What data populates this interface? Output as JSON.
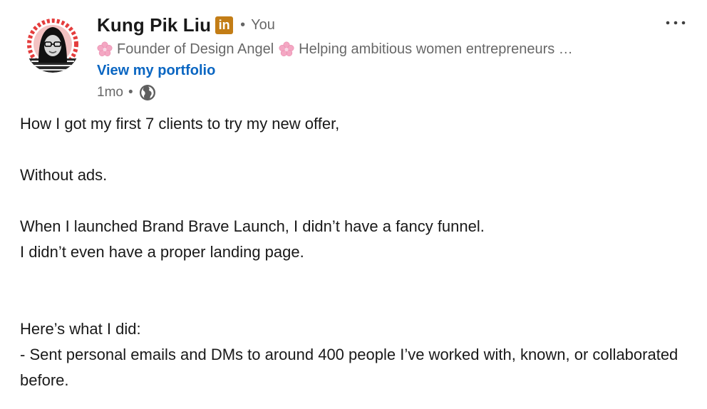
{
  "post": {
    "author": {
      "name": "Kung Pik Liu",
      "badge": "in",
      "separator": "•",
      "relation": "You",
      "headline_part1": "Founder of Design Angel",
      "headline_part2": "Helping ambitious women entrepreneurs …",
      "portfolio_link": "View my portfolio",
      "avatar_icon": "profile-photo"
    },
    "meta": {
      "age": "1mo",
      "separator": "•",
      "visibility_icon": "globe-icon"
    },
    "menu_icon": "more-options-icon",
    "body": [
      "How I got my first 7 clients to try my new offer,",
      "",
      "Without ads.",
      "",
      "When I launched Brand Brave Launch, I didn’t have a fancy funnel.",
      "I didn’t even have a proper landing page.",
      "",
      "",
      "Here’s what I did:",
      "- Sent personal emails and DMs to around 400 people I’ve worked with, known, or collaborated before."
    ]
  },
  "colors": {
    "link": "#0a66c2",
    "linkedin_badge": "#c37d16",
    "flower": "#f4a7c3",
    "avatar_ring": "#e43d3d"
  }
}
